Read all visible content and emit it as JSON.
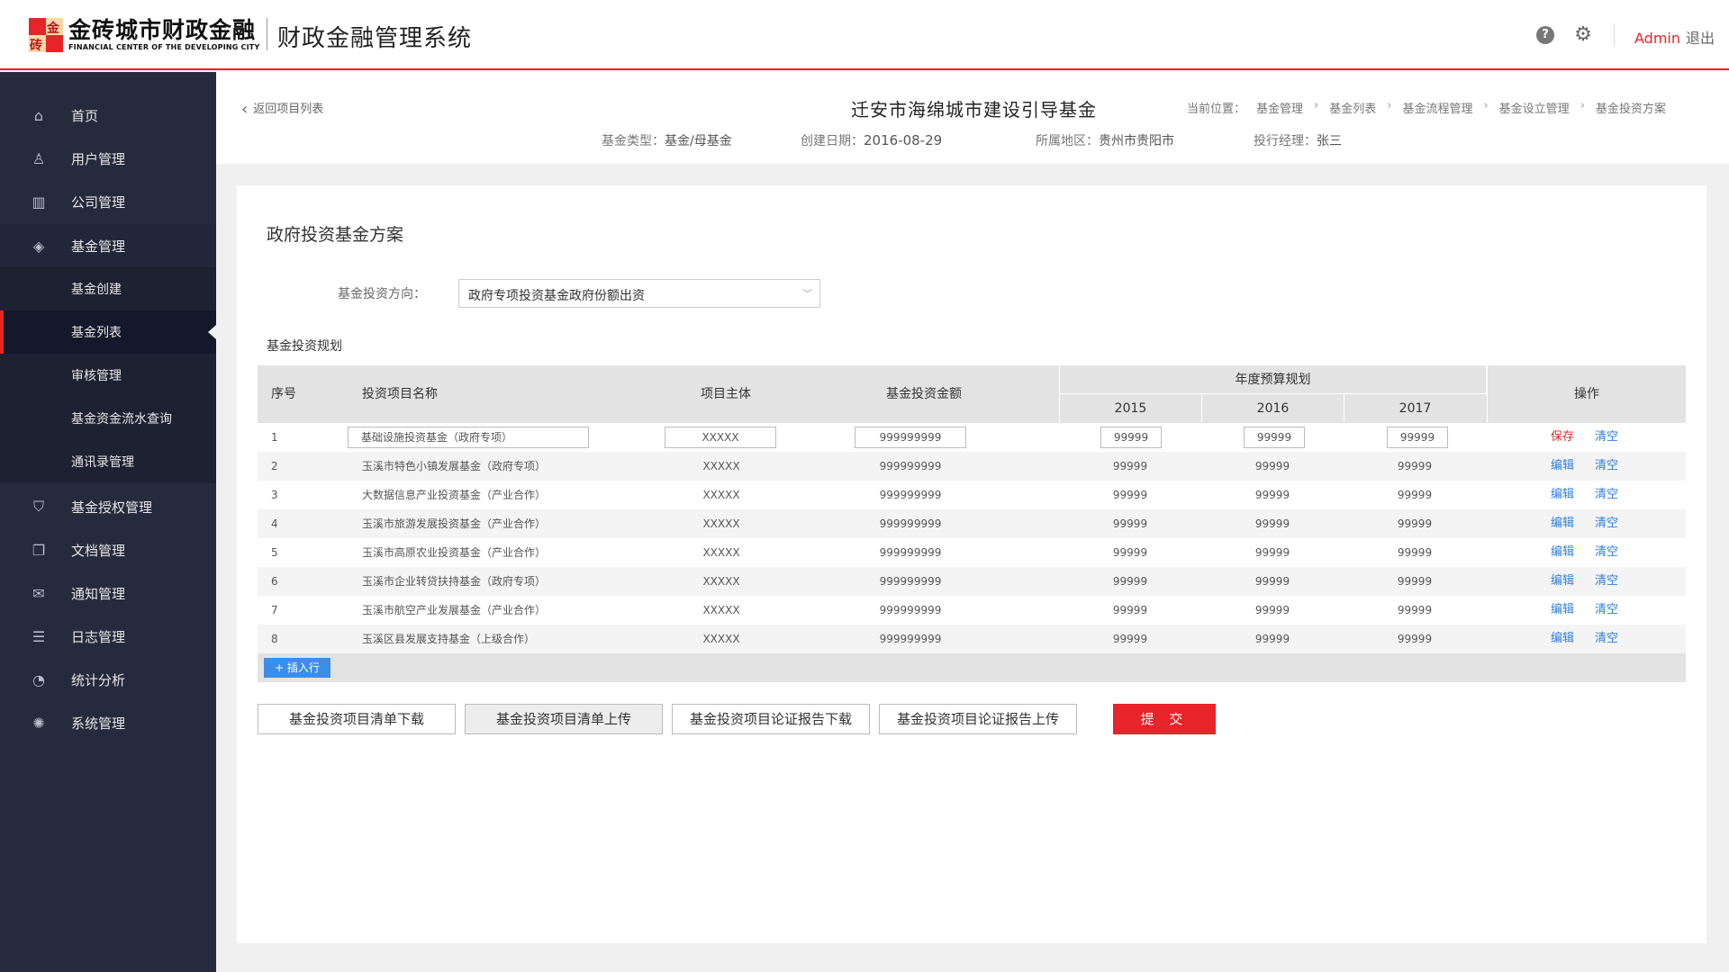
{
  "header": {
    "logo_cn": "金砖城市财政金融",
    "logo_en": "FINANCIAL CENTER OF THE DEVELOPING CITY",
    "logo_char1": "金",
    "logo_char2": "砖",
    "system_title": "财政金融管理系统",
    "help_icon": "?",
    "gear_icon": "⚙",
    "user_name": "Admin",
    "logout_label": "退出",
    "accent_color": "#e8232a"
  },
  "sidebar": {
    "items": [
      {
        "label": "首页",
        "icon": "home-icon",
        "glyph": "⌂"
      },
      {
        "label": "用户管理",
        "icon": "user-icon",
        "glyph": "♙"
      },
      {
        "label": "公司管理",
        "icon": "building-icon",
        "glyph": "▥"
      },
      {
        "label": "基金管理",
        "icon": "layers-icon",
        "glyph": "◈"
      },
      {
        "label": "基金授权管理",
        "icon": "shield-icon",
        "glyph": "⛉"
      },
      {
        "label": "文档管理",
        "icon": "document-icon",
        "glyph": "❐"
      },
      {
        "label": "通知管理",
        "icon": "mail-icon",
        "glyph": "✉"
      },
      {
        "label": "日志管理",
        "icon": "log-icon",
        "glyph": "☰"
      },
      {
        "label": "统计分析",
        "icon": "pie-chart-icon",
        "glyph": "◔"
      },
      {
        "label": "系统管理",
        "icon": "settings-icon",
        "glyph": "✺"
      }
    ],
    "sub_items": [
      {
        "label": "基金创建"
      },
      {
        "label": "基金列表"
      },
      {
        "label": "审核管理"
      },
      {
        "label": "基金资金流水查询"
      },
      {
        "label": "通讯录管理"
      }
    ]
  },
  "infobar": {
    "back_label": "返回项目列表",
    "fund_title": "迁安市海绵城市建设引导基金",
    "breadcrumb_prefix": "当前位置：",
    "breadcrumbs": [
      "基金管理",
      "基金列表",
      "基金流程管理",
      "基金设立管理",
      "基金投资方案"
    ],
    "fund_type_label": "基金类型：",
    "fund_type": "基金/母基金",
    "created_label": "创建日期：",
    "created_date": "2016-08-29",
    "region_label": "所属地区：",
    "region": "贵州市贵阳市",
    "manager_label": "投行经理：",
    "manager": "张三"
  },
  "main": {
    "section_title": "政府投资基金方案",
    "direction_label": "基金投资方向：",
    "direction_value": "政府专项投资基金政府份额出资",
    "plan_title": "基金投资规划",
    "table": {
      "headers": {
        "seq": "序号",
        "name": "投资项目名称",
        "subject": "项目主体",
        "amount": "基金投资金额",
        "budget": "年度预算规划",
        "years": [
          "2015",
          "2016",
          "2017"
        ],
        "ops": "操作"
      },
      "rows": [
        {
          "seq": "1",
          "name": "基础设施投资基金（政府专项）",
          "subject": "XXXXX",
          "amount": "999999999",
          "y2015": "99999",
          "y2016": "99999",
          "y2017": "99999",
          "op1": "保存",
          "op2": "清空"
        },
        {
          "seq": "2",
          "name": "玉溪市特色小镇发展基金（政府专项）",
          "subject": "XXXXX",
          "amount": "999999999",
          "y2015": "99999",
          "y2016": "99999",
          "y2017": "99999",
          "op1": "编辑",
          "op2": "清空"
        },
        {
          "seq": "3",
          "name": "大数据信息产业投资基金（产业合作）",
          "subject": "XXXXX",
          "amount": "999999999",
          "y2015": "99999",
          "y2016": "99999",
          "y2017": "99999",
          "op1": "编辑",
          "op2": "清空"
        },
        {
          "seq": "4",
          "name": "玉溪市旅游发展投资基金（产业合作）",
          "subject": "XXXXX",
          "amount": "999999999",
          "y2015": "99999",
          "y2016": "99999",
          "y2017": "99999",
          "op1": "编辑",
          "op2": "清空"
        },
        {
          "seq": "5",
          "name": "玉溪市高原农业投资基金（产业合作）",
          "subject": "XXXXX",
          "amount": "999999999",
          "y2015": "99999",
          "y2016": "99999",
          "y2017": "99999",
          "op1": "编辑",
          "op2": "清空"
        },
        {
          "seq": "6",
          "name": "玉溪市企业转贷扶持基金（政府专项）",
          "subject": "XXXXX",
          "amount": "999999999",
          "y2015": "99999",
          "y2016": "99999",
          "y2017": "99999",
          "op1": "编辑",
          "op2": "清空"
        },
        {
          "seq": "7",
          "name": "玉溪市航空产业发展基金（产业合作）",
          "subject": "XXXXX",
          "amount": "999999999",
          "y2015": "99999",
          "y2016": "99999",
          "y2017": "99999",
          "op1": "编辑",
          "op2": "清空"
        },
        {
          "seq": "8",
          "name": "玉溪区县发展支持基金（上级合作）",
          "subject": "XXXXX",
          "amount": "999999999",
          "y2015": "99999",
          "y2016": "99999",
          "y2017": "99999",
          "op1": "编辑",
          "op2": "清空"
        }
      ],
      "insert_label": "+ 插入行"
    },
    "actions": {
      "download_list": "基金投资项目清单下载",
      "upload_list": "基金投资项目清单上传",
      "download_report": "基金投资项目论证报告下载",
      "upload_report": "基金投资项目论证报告上传",
      "submit": "提 交"
    }
  }
}
